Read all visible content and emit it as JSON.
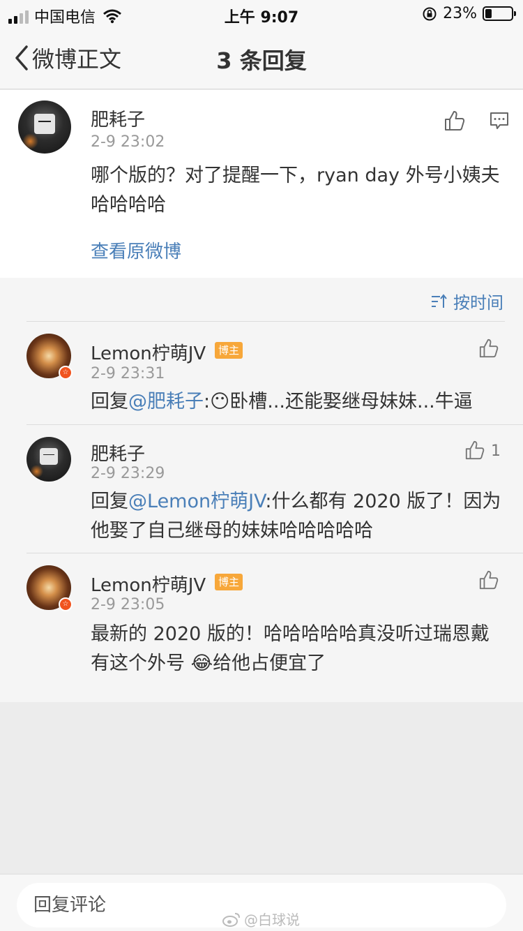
{
  "status_bar": {
    "carrier": "中国电信",
    "time": "上午 9:07",
    "battery_percent": "23%",
    "battery_level": 0.23
  },
  "nav": {
    "back_label": "微博正文",
    "title": "3 条回复"
  },
  "root_comment": {
    "author": "肥耗子",
    "time": "2-9 23:02",
    "text": "哪个版的？对了提醒一下，ryan day 外号小姨夫哈哈哈哈",
    "view_original": "查看原微博"
  },
  "sort_label": "按时间",
  "replies": [
    {
      "author": "Lemon柠萌JV",
      "badge": "博主",
      "time": "2-9 23:31",
      "prefix": "回复",
      "mention": "@肥耗子",
      "body": ":😶卧槽...还能娶继母妹妹...牛逼",
      "likes": ""
    },
    {
      "author": "肥耗子",
      "badge": "",
      "time": "2-9 23:29",
      "prefix": "回复",
      "mention": "@Lemon柠萌JV",
      "body": ":什么都有 2020 版了！因为他娶了自己继母的妹妹哈哈哈哈哈",
      "likes": "1"
    },
    {
      "author": "Lemon柠萌JV",
      "badge": "博主",
      "time": "2-9 23:05",
      "prefix": "",
      "mention": "",
      "body": "最新的 2020 版的！哈哈哈哈哈真没听过瑞恩戴有这个外号 😂给他占便宜了",
      "likes": ""
    }
  ],
  "bottom": {
    "reply_placeholder": "回复评论"
  },
  "watermark": "@白球说",
  "icons": {
    "like": "thumbs-up-icon",
    "comment": "comment-icon",
    "sort": "sort-icon",
    "back": "chevron-left-icon"
  },
  "colors": {
    "link": "#4a7fb8",
    "badge": "#f7a73a",
    "verified": "#f0541f"
  }
}
